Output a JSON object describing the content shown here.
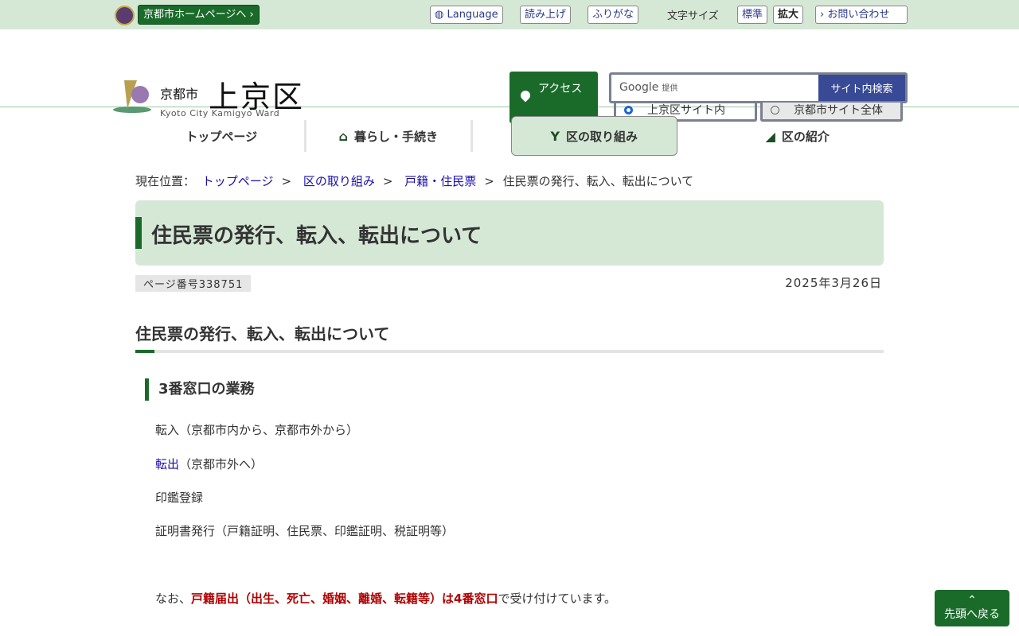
{
  "topbar": {
    "home_link": "京都市ホームページへ ›",
    "language": "Language",
    "read_aloud": "読み上げ",
    "furigana": "ふりがな",
    "font_size_label": "文字サイズ",
    "font_standard": "標準",
    "font_large": "拡大",
    "contact": "› お問い合わせ"
  },
  "header": {
    "logo_city": "京都市",
    "logo_ward": "上京区",
    "logo_en": "Kyoto City Kamigyo Ward",
    "access": "アクセス",
    "search_provider": "Google",
    "search_provider_suffix": "提供",
    "search_button": "サイト内検索",
    "radio_ward": "上京区サイト内",
    "radio_city": "京都市サイト全体"
  },
  "nav": {
    "items": [
      {
        "label": "トップページ"
      },
      {
        "label": "暮らし・手続き"
      },
      {
        "label": "区の取り組み"
      },
      {
        "label": "区の紹介"
      }
    ]
  },
  "breadcrumb": {
    "label": "現在位置：",
    "links": [
      "トップページ",
      "区の取り組み",
      "戸籍・住民票"
    ],
    "current": "住民票の発行、転入、転出について"
  },
  "page": {
    "title": "住民票の発行、転入、転出について",
    "page_number": "ページ番号338751",
    "date": "2025年3月26日",
    "heading": "住民票の発行、転入、転出について",
    "section": "3番窓口の業務",
    "items": [
      "転入（京都市内から、京都市外から）",
      "転出",
      "（京都市外へ）",
      "印鑑登録",
      "証明書発行（戸籍証明、住民票、印鑑証明、税証明等）"
    ],
    "note_prefix": "なお、",
    "note_red": "戸籍届出（出生、死亡、婚姻、離婚、転籍等）は4番窓口",
    "note_suffix": "で受け付けています。"
  },
  "back_to_top": "先頭へ戻る",
  "colors": {
    "accent": "#1a6b2a",
    "light": "#d5e8d6",
    "search": "#384a96"
  }
}
